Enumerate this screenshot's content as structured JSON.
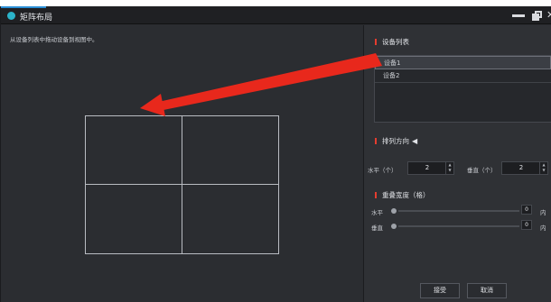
{
  "window": {
    "title": "矩阵布局"
  },
  "left": {
    "hint": "从设备列表中拖动设备到视图中。"
  },
  "device_section": {
    "title": "设备列表",
    "devices": [
      {
        "label": "设备1",
        "selected": true
      },
      {
        "label": "设备2",
        "selected": false
      }
    ]
  },
  "arrange_section": {
    "title": "排列方向",
    "horizontal_label": "水平（个）",
    "horizontal_value": "2",
    "vertical_label": "垂直（个）",
    "vertical_value": "2"
  },
  "overlap_section": {
    "title": "重叠宽度（格）",
    "horizontal_label": "水平",
    "horizontal_value": "0",
    "horizontal_unit": "内",
    "vertical_label": "垂直",
    "vertical_value": "0",
    "vertical_unit": "内"
  },
  "buttons": {
    "ok": "接受",
    "cancel": "取消"
  },
  "colors": {
    "annotation_arrow": "#e8281c",
    "section_mark": "#e53d2f",
    "app_icon": "#2bb3c9"
  },
  "grid": {
    "rows": 2,
    "cols": 2
  }
}
